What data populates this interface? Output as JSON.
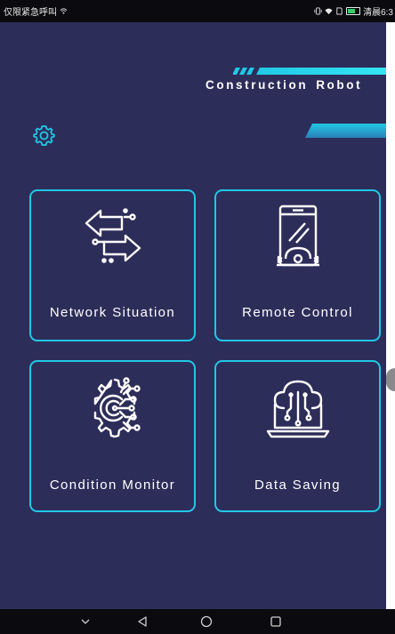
{
  "status_bar": {
    "carrier": "仅限紧急呼叫",
    "carrier_icon": "wifi-icon",
    "right_text": "清晨6:3",
    "icons": [
      "vibrate-icon",
      "wifi-icon",
      "sim-icon",
      "battery-icon"
    ]
  },
  "header": {
    "title_word1": "Construction",
    "title_word2": "Robot",
    "accent_color": "#20c8e6"
  },
  "settings": {
    "icon": "gear-icon"
  },
  "cards": [
    {
      "label": "Network Situation",
      "icon": "network-transfer-icon"
    },
    {
      "label": "Remote Control",
      "icon": "remote-control-phone-icon"
    },
    {
      "label": "Condition Monitor",
      "icon": "gear-circuit-icon"
    },
    {
      "label": "Data Saving",
      "icon": "cloud-laptop-icon"
    }
  ],
  "nav_bar": {
    "buttons": [
      "chevron-down-icon",
      "back-triangle-icon",
      "home-circle-icon",
      "recents-square-icon"
    ]
  }
}
